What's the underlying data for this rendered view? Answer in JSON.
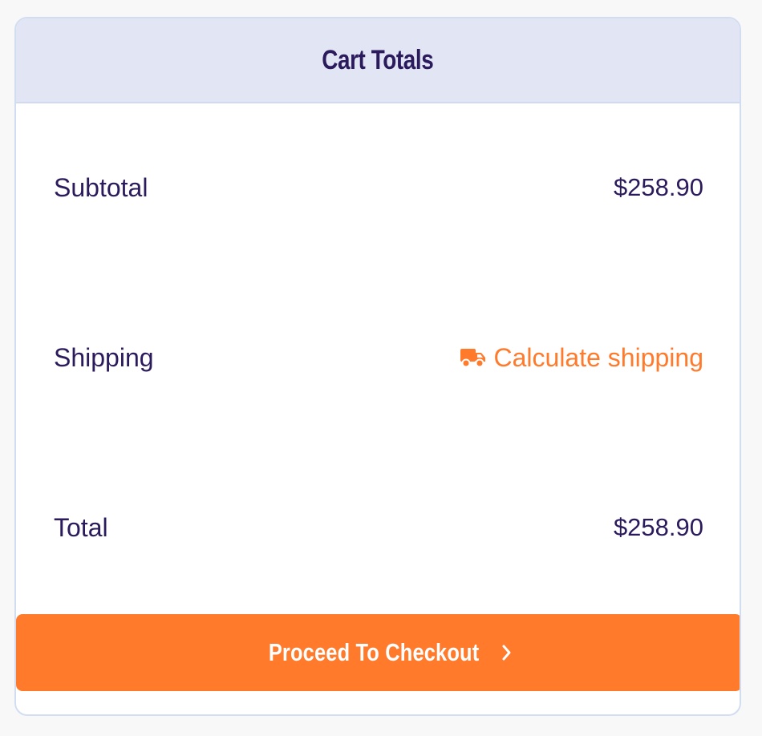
{
  "cart": {
    "title": "Cart Totals",
    "subtotal": {
      "label": "Subtotal",
      "value": "$258.90"
    },
    "shipping": {
      "label": "Shipping",
      "action_label": "Calculate shipping",
      "icon": "truck-icon"
    },
    "total": {
      "label": "Total",
      "value": "$258.90"
    },
    "checkout": {
      "label": "Proceed To Checkout",
      "icon": "chevron-right-icon"
    }
  },
  "colors": {
    "accent": "#ff7a2b",
    "text": "#2b1a5c",
    "header_bg": "#e2e6f4",
    "border": "#d3ddf1"
  }
}
